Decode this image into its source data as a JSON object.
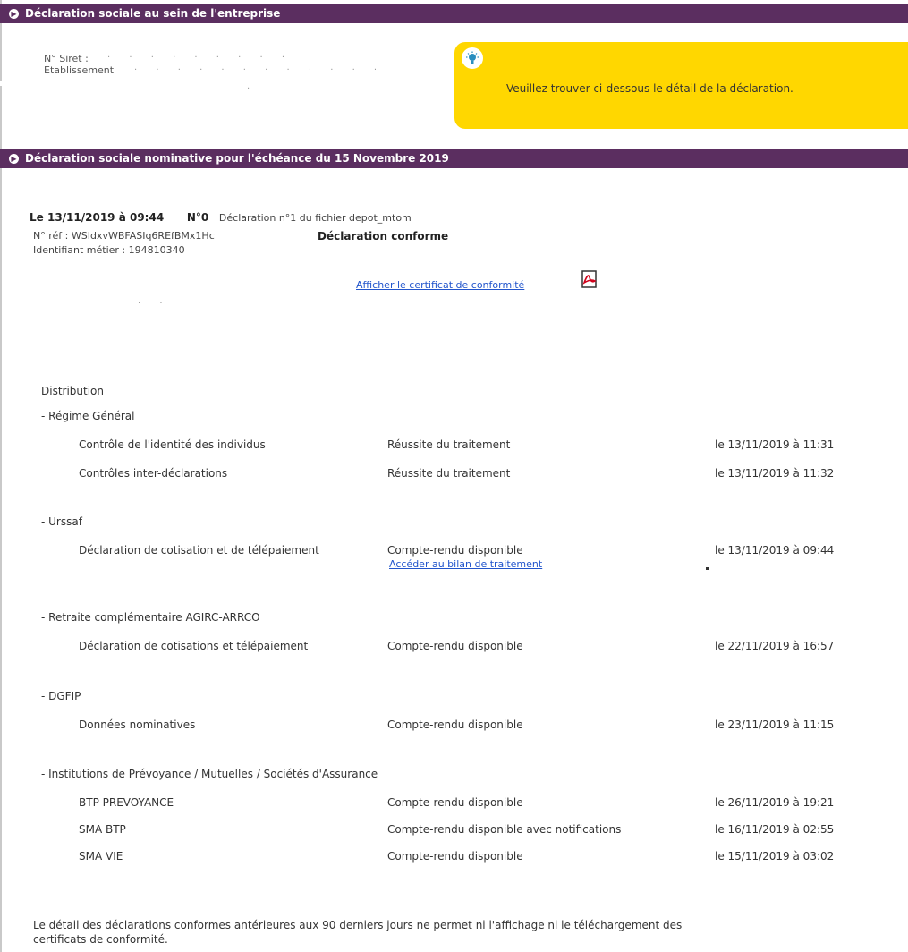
{
  "section1": {
    "title": "Déclaration sociale au sein de l'entreprise",
    "siret_label": "N° Siret :",
    "etab_label": "Etablissement",
    "info_message": "Veuillez trouver ci-dessous le détail de la déclaration."
  },
  "section2": {
    "title": "Déclaration sociale nominative pour l'échéance du 15 Novembre 2019"
  },
  "declaration": {
    "date": "Le 13/11/2019 à 09:44",
    "number": "N°0",
    "description": "Déclaration n°1 du fichier depot_mtom",
    "ref": "N° réf : WSIdxvWBFASIq6REfBMx1Hc",
    "status": "Déclaration conforme",
    "identifiant": "Identifiant métier : 194810340",
    "certificate_link": "Afficher le certificat de conformité"
  },
  "distribution": {
    "title": "Distribution",
    "groups": [
      {
        "name": "- Régime Général",
        "rows": [
          {
            "label": "Contrôle de l'identité des individus",
            "status": "Réussite du traitement",
            "date": "le 13/11/2019 à 11:31"
          },
          {
            "label": "Contrôles inter-déclarations",
            "status": "Réussite du traitement",
            "date": "le 13/11/2019 à 11:32"
          }
        ]
      },
      {
        "name": "- Urssaf",
        "rows": [
          {
            "label": "Déclaration de cotisation et de télépaiement",
            "status": "Compte-rendu disponible",
            "date": "le 13/11/2019 à 09:44",
            "link": "Accéder au bilan de traitement"
          }
        ]
      },
      {
        "name": "- Retraite complémentaire AGIRC-ARRCO",
        "rows": [
          {
            "label": "Déclaration de cotisations et télépaiement",
            "status": "Compte-rendu disponible",
            "date": "le 22/11/2019 à 16:57"
          }
        ]
      },
      {
        "name": "- DGFIP",
        "rows": [
          {
            "label": "Données nominatives",
            "status": "Compte-rendu disponible",
            "date": "le 23/11/2019 à 11:15"
          }
        ]
      },
      {
        "name": "- Institutions de Prévoyance / Mutuelles / Sociétés d'Assurance",
        "rows": [
          {
            "label": "BTP PREVOYANCE",
            "status": "Compte-rendu disponible",
            "date": "le 26/11/2019 à 19:21"
          },
          {
            "label": "SMA BTP",
            "status": "Compte-rendu disponible avec notifications",
            "date": "le 16/11/2019 à 02:55"
          },
          {
            "label": "SMA VIE",
            "status": "Compte-rendu disponible",
            "date": "le 15/11/2019 à 03:02"
          }
        ]
      }
    ]
  },
  "footer_note_line1": "Le détail des déclarations conformes antérieures aux 90 derniers jours ne permet ni l'affichage ni le téléchargement des",
  "footer_note_line2": "certificats de conformité.",
  "icons": {
    "section_bullet": "chevron-right-icon",
    "info": "lightbulb-icon",
    "certificate": "pdf-icon"
  },
  "colors": {
    "header_bar": "#5b2e60",
    "info_box": "#ffd700",
    "link": "#2255cc"
  }
}
